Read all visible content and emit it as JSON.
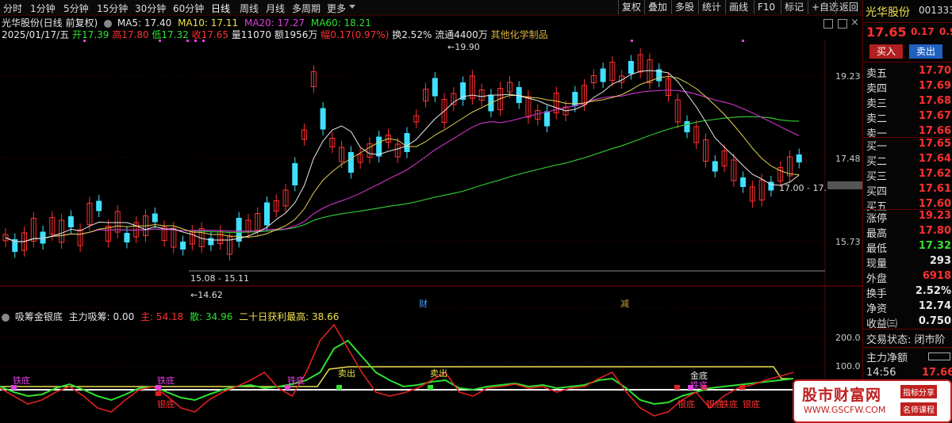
{
  "toolbar": {
    "periods": [
      "分时",
      "1分钟",
      "5分钟",
      "15分钟",
      "30分钟",
      "60分钟",
      "日线",
      "周线",
      "月线",
      "多周期",
      "更多"
    ],
    "active": "日线",
    "buttons": [
      "复权",
      "叠加",
      "多股",
      "统计",
      "画线",
      "F10",
      "标记",
      "+自选",
      "返回"
    ]
  },
  "info": {
    "title": "光华股份(日线 前复权)",
    "ma5": "MA5: 17.40",
    "ma10": "MA10: 17.11",
    "ma20": "MA20: 17.27",
    "ma60": "MA60: 18.21",
    "date": "2025/01/17/五",
    "open": "开17.39",
    "high": "高17.80",
    "low": "低17.32",
    "close": "收17.65",
    "volume": "量11070",
    "amount": "额1956万",
    "change": "幅0.17(0.97%)",
    "turnover": "换2.52%",
    "float": "流通4400万",
    "industry": "其他化学制品"
  },
  "chart_annotations": {
    "high_marker": "19.90",
    "low_marker": "14.62",
    "range1": "15.08 - 15.11",
    "range2": "17.00 - 17.",
    "ch1": "财",
    "ch2": "减"
  },
  "price_axis": [
    "19.23",
    "17.48",
    "15.73"
  ],
  "indicator": {
    "name": "吸筹金银底",
    "main_absorb": "主力吸筹: 0.00",
    "main": "主: 54.18",
    "retail": "散: 34.96",
    "profit": "二十日获利最高: 38.66",
    "axis": [
      "200.0",
      "100.0"
    ],
    "labels": [
      "铁底",
      "铁底",
      "铁底",
      "卖出",
      "卖出",
      "金底",
      "铁底",
      "银底",
      "银底",
      "银底",
      "铁底",
      "银底"
    ]
  },
  "right_panel": {
    "name": "光华股份",
    "code": "001333",
    "price": "17.65",
    "change": "0.17",
    "pct": "0.9",
    "buy_btn": "买入",
    "sell_btn": "卖出",
    "sells": [
      [
        "卖五",
        "17.70"
      ],
      [
        "卖四",
        "17.69"
      ],
      [
        "卖三",
        "17.68"
      ],
      [
        "卖二",
        "17.67"
      ],
      [
        "卖一",
        "17.66"
      ]
    ],
    "buys": [
      [
        "买一",
        "17.65"
      ],
      [
        "买二",
        "17.64"
      ],
      [
        "买三",
        "17.62"
      ],
      [
        "买四",
        "17.61"
      ],
      [
        "买五",
        "17.60"
      ]
    ],
    "stats": [
      [
        "涨停",
        "19.23"
      ],
      [
        "最高",
        "17.80"
      ],
      [
        "最低",
        "17.32"
      ],
      [
        "现量",
        "293"
      ],
      [
        "外盘",
        "6918"
      ],
      [
        "换手",
        "2.52%"
      ],
      [
        "净资",
        "12.74"
      ],
      [
        "收益㈢",
        "0.750"
      ]
    ],
    "trade_state": "交易状态: 闭市阶",
    "main_net": "主力净额",
    "time": "14:56",
    "time_price": "17.66"
  },
  "watermark": {
    "brand": "股市财富网",
    "url": "WWW.GSCFW.COM",
    "tag1": "指标分享",
    "tag2": "名师课程"
  },
  "colors": {
    "up": "#ff3030",
    "down": "#40e0ff",
    "ma5": "#e8e8e8",
    "ma10": "#f0e050",
    "ma20": "#e040e0",
    "ma60": "#30e030"
  }
}
